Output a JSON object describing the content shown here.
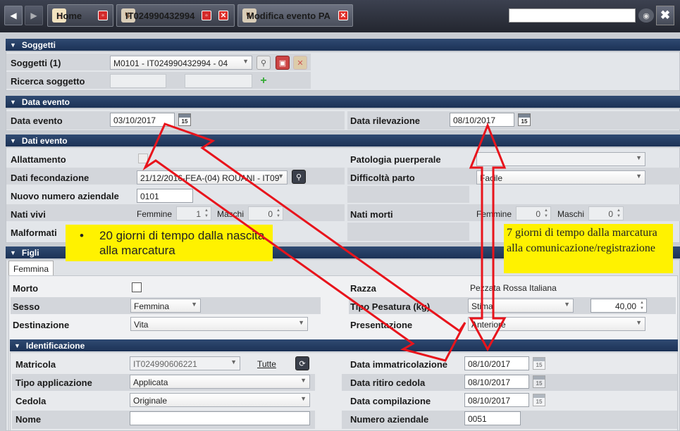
{
  "tabs": [
    {
      "label": "Home"
    },
    {
      "label": "IT024990432994"
    },
    {
      "label": "Modifica evento PA"
    }
  ],
  "sections": {
    "soggetti": "Soggetti",
    "data_evento": "Data evento",
    "dati_evento": "Dati evento",
    "figli": "Figli",
    "identificazione": "Identificazione"
  },
  "soggetti": {
    "label": "Soggetti (1)",
    "value": "M0101 - IT024990432994 - 04",
    "ricerca_label": "Ricerca soggetto"
  },
  "data_evento": {
    "label": "Data evento",
    "value": "03/10/2017",
    "rilevazione_label": "Data rilevazione",
    "rilevazione_value": "08/10/2017",
    "cal_num": "15"
  },
  "dati_evento": {
    "allattamento": "Allattamento",
    "patologia": "Patologia puerperale",
    "fecondazione_label": "Dati fecondazione",
    "fecondazione_value": "21/12/2016-FEA-(04) ROUANI - IT09",
    "difficolta_label": "Difficoltà parto",
    "difficolta_value": "Facile",
    "nuovo_numero_label": "Nuovo numero aziendale",
    "nuovo_numero_value": "0101",
    "nati_vivi": "Nati vivi",
    "nati_morti": "Nati morti",
    "femmine": "Femmine",
    "maschi": "Maschi",
    "vivi_femmine": "1",
    "vivi_maschi": "0",
    "morti_femmine": "0",
    "morti_maschi": "0",
    "malformati": "Malformati"
  },
  "figli": {
    "tab": "Femmina",
    "morto": "Morto",
    "razza_label": "Razza",
    "razza_value": "Pezzata Rossa Italiana",
    "sesso_label": "Sesso",
    "sesso_value": "Femmina",
    "tipo_pesatura_label": "Tipo Pesatura (kg)",
    "tipo_pesatura_value": "Stima",
    "peso_value": "40,00",
    "destinazione_label": "Destinazione",
    "destinazione_value": "Vita",
    "presentazione_label": "Presentazione",
    "presentazione_value": "Anteriore"
  },
  "identificazione": {
    "matricola_label": "Matricola",
    "matricola_value": "IT024990606221",
    "tutte": "Tutte",
    "data_immatricolazione_label": "Data immatricolazione",
    "data_immatricolazione_value": "08/10/2017",
    "tipo_applicazione_label": "Tipo applicazione",
    "tipo_applicazione_value": "Applicata",
    "data_ritiro_label": "Data ritiro cedola",
    "data_ritiro_value": "08/10/2017",
    "cedola_label": "Cedola",
    "cedola_value": "Originale",
    "data_compilazione_label": "Data compilazione",
    "data_compilazione_value": "08/10/2017",
    "nome_label": "Nome",
    "numero_aziendale_label": "Numero aziendale",
    "numero_aziendale_value": "0051"
  },
  "annotations": {
    "note1": "20 giorni di tempo dalla nascita alla marcatura",
    "note2": "7 giorni di tempo dalla marcatura alla comunicazione/registrazione"
  },
  "colors": {
    "section_header": "#1c3256",
    "annotation_bg": "#fff200",
    "arrow": "#e8141c"
  }
}
